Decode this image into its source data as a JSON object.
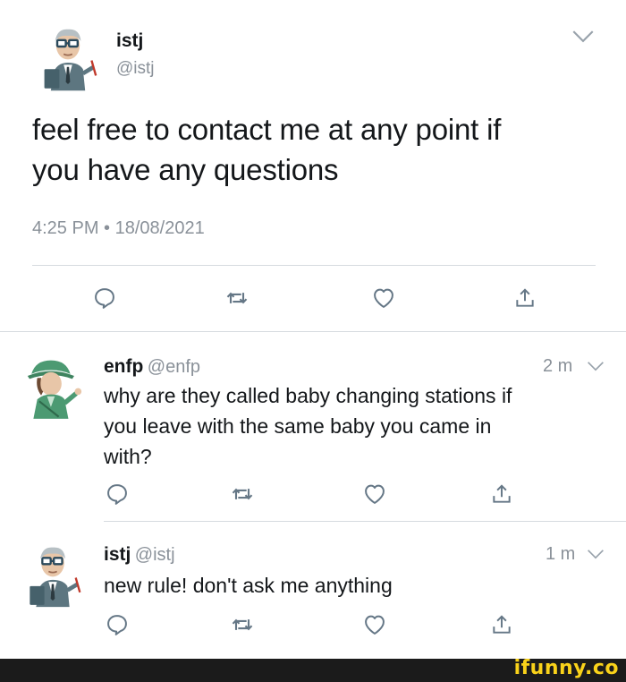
{
  "main_tweet": {
    "name": "istj",
    "handle": "@istj",
    "text_line1": "feel free to contact me at any point if",
    "text_line2": "you have any questions",
    "timestamp": "4:25 PM • 18/08/2021"
  },
  "reply1": {
    "name": "enfp",
    "handle": "@enfp",
    "time": "2 m",
    "line1": "why are they called baby changing stations if",
    "line2": "you leave with the same baby you came in",
    "line3": "with?"
  },
  "reply2": {
    "name": "istj",
    "handle": "@istj",
    "time": "1 m",
    "line1": "new rule! don't ask me anything"
  },
  "icons": [
    "reply-icon",
    "retweet-icon",
    "like-icon",
    "share-icon",
    "chevron-down-icon"
  ],
  "colors": {
    "text": "#14171a",
    "muted": "#8a9199",
    "divider": "#d6dbdf",
    "footer": "#1b1b1b",
    "brand": "#f9d21a"
  },
  "watermark": "ifunny.co"
}
